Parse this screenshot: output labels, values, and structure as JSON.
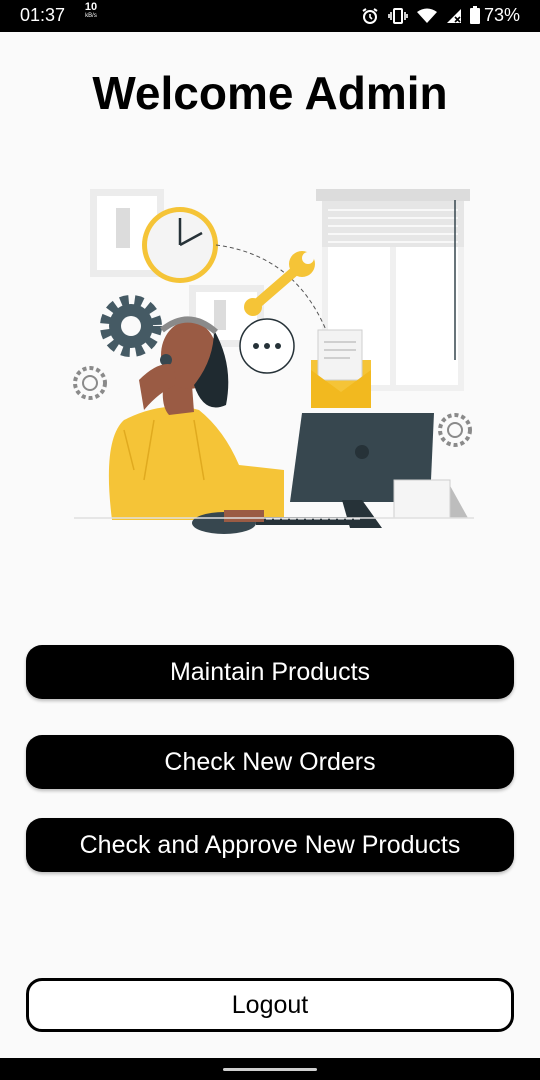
{
  "status_bar": {
    "time": "01:37",
    "net_speed_value": "10",
    "net_speed_unit": "kB/s",
    "battery_percent": "73%",
    "icons": [
      "alarm-icon",
      "vibrate-icon",
      "wifi-icon",
      "no-signal-icon",
      "battery-icon"
    ]
  },
  "header": {
    "title": "Welcome Admin"
  },
  "illustration": {
    "icon": "customer-support-illustration"
  },
  "actions": {
    "maintain_products": "Maintain Products",
    "check_new_orders": "Check New Orders",
    "approve_products": "Check and Approve New Products",
    "logout": "Logout"
  },
  "colors": {
    "background": "#fafafa",
    "button": "#000000",
    "button_text": "#ffffff",
    "accent_yellow": "#f5c437",
    "monitor": "#37474f"
  }
}
